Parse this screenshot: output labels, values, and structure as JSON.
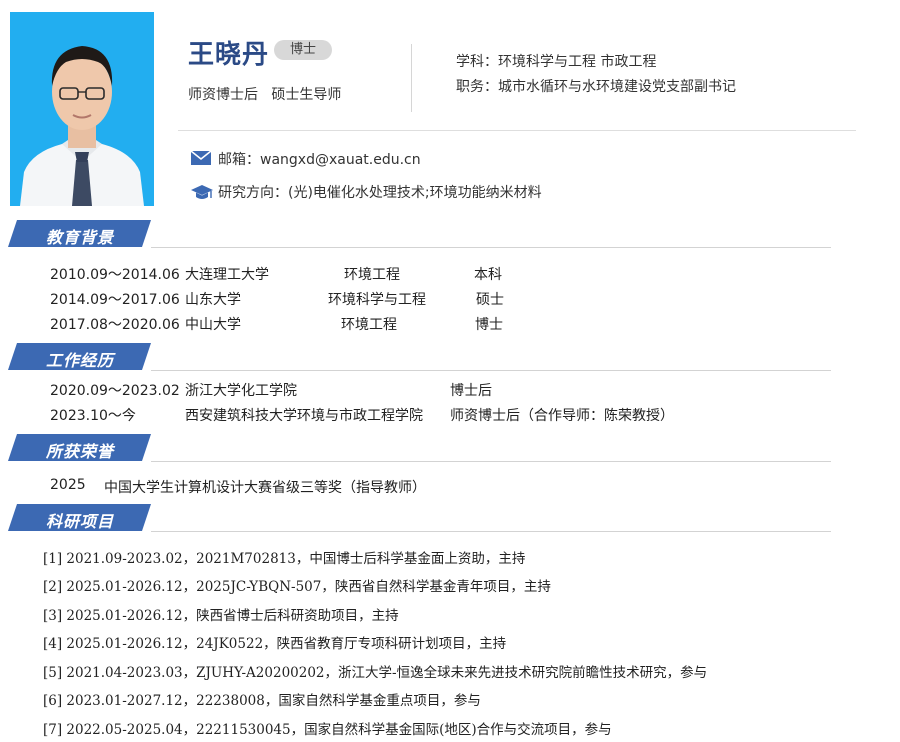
{
  "profile": {
    "name": "王晓丹",
    "degree_badge": "博士",
    "subtitle": "师资博士后   硕士生导师",
    "discipline": "学科：环境科学与工程 市政工程",
    "position": "职务：城市水循环与水环境建设党支部副书记",
    "email": "邮箱：wangxd@xauat.edu.cn",
    "research": "研究方向：(光)电催化水处理技术;环境功能纳米材料",
    "photo_bg_color": "#22aef0"
  },
  "colors": {
    "accent": "#3c69b3",
    "name_color": "#2b4a86"
  },
  "sections": {
    "education": "教育背景",
    "work": "工作经历",
    "honors": "所获荣誉",
    "projects": "科研项目"
  },
  "education": [
    {
      "period": "2010.09～2014.06",
      "school": "大连理工大学",
      "major": "环境工程",
      "degree": "本科"
    },
    {
      "period": "2014.09～2017.06",
      "school": "山东大学",
      "major": "环境科学与工程",
      "degree": "硕士"
    },
    {
      "period": "2017.08～2020.06",
      "school": "中山大学",
      "major": "环境工程",
      "degree": "博士"
    }
  ],
  "work": [
    {
      "period": "2020.09～2023.02",
      "org": "浙江大学化工学院",
      "title": "博士后"
    },
    {
      "period": "2023.10～今",
      "org": "西安建筑科技大学环境与市政工程学院",
      "title": "师资博士后（合作导师：陈荣教授）"
    }
  ],
  "honors": [
    {
      "year": "2025",
      "award": "中国大学生计算机设计大赛省级三等奖（指导教师）"
    }
  ],
  "projects": [
    "[1] 2021.09-2023.02，2021M702813，中国博士后科学基金面上资助，主持",
    "[2] 2025.01-2026.12，2025JC-YBQN-507，陕西省自然科学基金青年项目，主持",
    "[3] 2025.01-2026.12，陕西省博士后科研资助项目，主持",
    "[4] 2025.01-2026.12，24JK0522，陕西省教育厅专项科研计划项目，主持",
    "[5] 2021.04-2023.03，ZJUHY-A20200202，浙江大学-恒逸全球未来先进技术研究院前瞻性技术研究，参与",
    "[6] 2023.01-2027.12，22238008，国家自然科学基金重点项目，参与",
    "[7] 2022.05-2025.04，22211530045，国家自然科学基金国际(地区)合作与交流项目，参与"
  ]
}
